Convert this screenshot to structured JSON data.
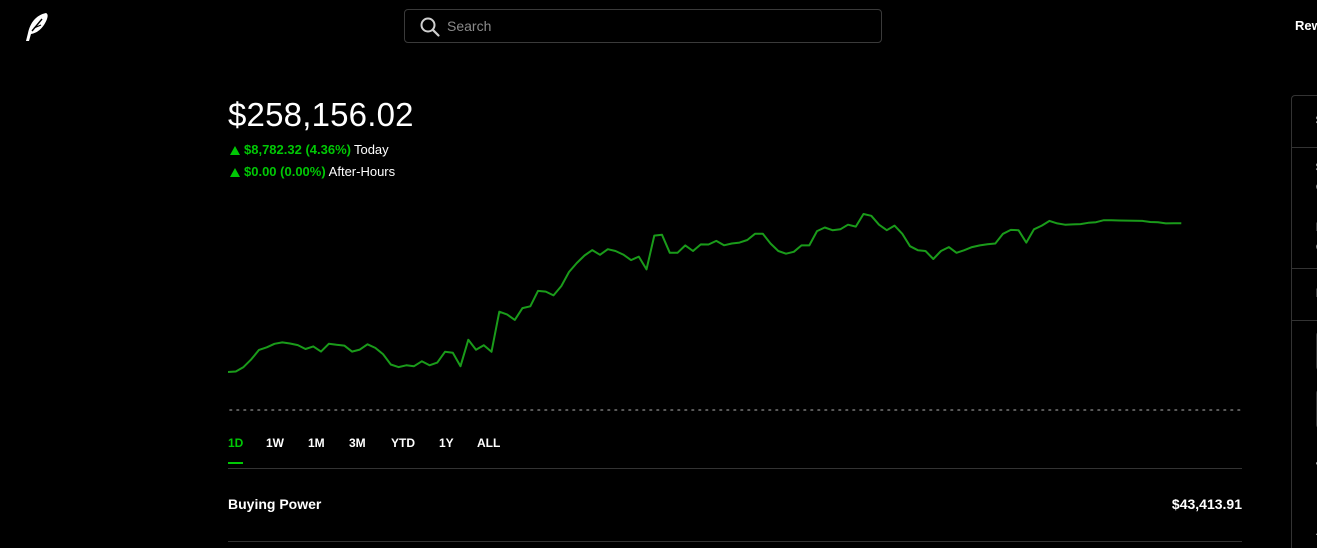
{
  "app": {
    "logo": "robinhood-feather-logo"
  },
  "search": {
    "placeholder": "Search",
    "icon": "search-icon"
  },
  "nav": {
    "rewards_label": "Rew"
  },
  "portfolio": {
    "value": "$258,156.02",
    "today": {
      "amount": "$8,782.32 (4.36%)",
      "label": "Today"
    },
    "after_hours": {
      "amount": "$0.00 (0.00%)",
      "label": "After-Hours"
    }
  },
  "colors": {
    "accent": "#00c805",
    "line": "#1a9b1a",
    "background": "#000000",
    "divider": "#333333"
  },
  "ranges": [
    {
      "label": "1D",
      "active": true
    },
    {
      "label": "1W",
      "active": false
    },
    {
      "label": "1M",
      "active": false
    },
    {
      "label": "3M",
      "active": false
    },
    {
      "label": "YTD",
      "active": false
    },
    {
      "label": "1Y",
      "active": false
    },
    {
      "label": "ALL",
      "active": false
    }
  ],
  "buying_power": {
    "label": "Buying Power",
    "value": "$43,413.91"
  },
  "chart_data": {
    "type": "line",
    "title": "",
    "xlabel": "",
    "ylabel": "",
    "grid": false,
    "y": [
      247520,
      247560,
      247900,
      248500,
      249230,
      249430,
      249700,
      249810,
      249720,
      249600,
      249300,
      249500,
      249100,
      249700,
      249620,
      249560,
      249100,
      249250,
      249660,
      249380,
      248900,
      248100,
      247900,
      248040,
      247970,
      248350,
      248040,
      248250,
      249080,
      249010,
      247970,
      250010,
      249240,
      249590,
      249080,
      252180,
      251970,
      251550,
      252460,
      252600,
      253790,
      253730,
      253440,
      254160,
      255250,
      255940,
      256520,
      256940,
      256580,
      257010,
      256870,
      256590,
      256170,
      256440,
      255450,
      258060,
      258120,
      256730,
      256730,
      257300,
      256870,
      257380,
      257370,
      257650,
      257310,
      257450,
      257520,
      257720,
      258200,
      258200,
      257450,
      256870,
      256660,
      256810,
      257300,
      257300,
      258410,
      258690,
      258480,
      258550,
      258900,
      258760,
      259730,
      259590,
      258900,
      258480,
      258830,
      258200,
      257240,
      256930,
      256870,
      256250,
      256870,
      257170,
      256730,
      256930,
      257170,
      257300,
      257390,
      257450,
      258200,
      258500,
      258480,
      257520,
      258550,
      258830,
      259200,
      259000,
      258900,
      258930,
      258950,
      259050,
      259100,
      259250,
      259240,
      259230,
      259220,
      259210,
      259200,
      259110,
      259100,
      259000,
      259020,
      259010
    ]
  },
  "side_panel": {
    "texts": [
      "$",
      "$",
      "C",
      "I",
      "C",
      "I",
      "V",
      "A"
    ]
  }
}
